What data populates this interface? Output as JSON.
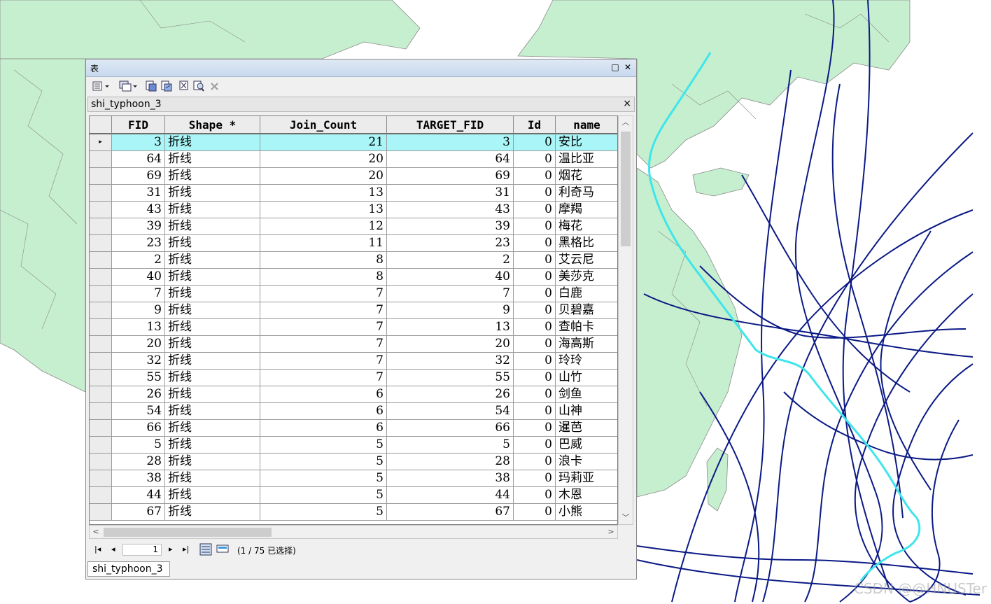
{
  "window": {
    "title": "表",
    "maximize_glyph": "□",
    "close_glyph": "✕"
  },
  "layer_table": {
    "name": "shi_typhoon_3",
    "close_glyph": "×"
  },
  "columns": [
    "FID",
    "Shape *",
    "Join_Count",
    "TARGET_FID",
    "Id",
    "name"
  ],
  "rows": [
    {
      "FID": "3",
      "shape": "折线",
      "join": "21",
      "target": "3",
      "id": "0",
      "name": "安比",
      "selected": true
    },
    {
      "FID": "64",
      "shape": "折线",
      "join": "20",
      "target": "64",
      "id": "0",
      "name": "温比亚"
    },
    {
      "FID": "69",
      "shape": "折线",
      "join": "20",
      "target": "69",
      "id": "0",
      "name": "烟花"
    },
    {
      "FID": "31",
      "shape": "折线",
      "join": "13",
      "target": "31",
      "id": "0",
      "name": "利奇马"
    },
    {
      "FID": "43",
      "shape": "折线",
      "join": "13",
      "target": "43",
      "id": "0",
      "name": "摩羯"
    },
    {
      "FID": "39",
      "shape": "折线",
      "join": "12",
      "target": "39",
      "id": "0",
      "name": "梅花"
    },
    {
      "FID": "23",
      "shape": "折线",
      "join": "11",
      "target": "23",
      "id": "0",
      "name": "黑格比"
    },
    {
      "FID": "2",
      "shape": "折线",
      "join": "8",
      "target": "2",
      "id": "0",
      "name": "艾云尼"
    },
    {
      "FID": "40",
      "shape": "折线",
      "join": "8",
      "target": "40",
      "id": "0",
      "name": "美莎克"
    },
    {
      "FID": "7",
      "shape": "折线",
      "join": "7",
      "target": "7",
      "id": "0",
      "name": "白鹿"
    },
    {
      "FID": "9",
      "shape": "折线",
      "join": "7",
      "target": "9",
      "id": "0",
      "name": "贝碧嘉"
    },
    {
      "FID": "13",
      "shape": "折线",
      "join": "7",
      "target": "13",
      "id": "0",
      "name": "查帕卡"
    },
    {
      "FID": "20",
      "shape": "折线",
      "join": "7",
      "target": "20",
      "id": "0",
      "name": "海高斯"
    },
    {
      "FID": "32",
      "shape": "折线",
      "join": "7",
      "target": "32",
      "id": "0",
      "name": "玲玲"
    },
    {
      "FID": "55",
      "shape": "折线",
      "join": "7",
      "target": "55",
      "id": "0",
      "name": "山竹"
    },
    {
      "FID": "26",
      "shape": "折线",
      "join": "6",
      "target": "26",
      "id": "0",
      "name": "剑鱼"
    },
    {
      "FID": "54",
      "shape": "折线",
      "join": "6",
      "target": "54",
      "id": "0",
      "name": "山神"
    },
    {
      "FID": "66",
      "shape": "折线",
      "join": "6",
      "target": "66",
      "id": "0",
      "name": "暹芭"
    },
    {
      "FID": "5",
      "shape": "折线",
      "join": "5",
      "target": "5",
      "id": "0",
      "name": "巴威"
    },
    {
      "FID": "28",
      "shape": "折线",
      "join": "5",
      "target": "28",
      "id": "0",
      "name": "浪卡"
    },
    {
      "FID": "38",
      "shape": "折线",
      "join": "5",
      "target": "38",
      "id": "0",
      "name": "玛莉亚"
    },
    {
      "FID": "44",
      "shape": "折线",
      "join": "5",
      "target": "44",
      "id": "0",
      "name": "木恩"
    },
    {
      "FID": "67",
      "shape": "折线",
      "join": "5",
      "target": "67",
      "id": "0",
      "name": "小熊"
    }
  ],
  "navigation": {
    "page_value": "1",
    "status": "(1 / 75 已选择)"
  },
  "bottom_tab": "shi_typhoon_3",
  "watermark": "CSDN @@HNUSTer",
  "colors": {
    "land": "#c6efcf",
    "track": "#0b1a85",
    "highlight_track": "#3ee6ea",
    "selected_row": "#a9f5f7"
  },
  "icons": [
    "table-options-icon",
    "related-tables-icon",
    "select-by-attributes-icon",
    "switch-selection-icon",
    "clear-selection-icon",
    "zoom-to-selected-icon",
    "delete-selected-icon"
  ]
}
